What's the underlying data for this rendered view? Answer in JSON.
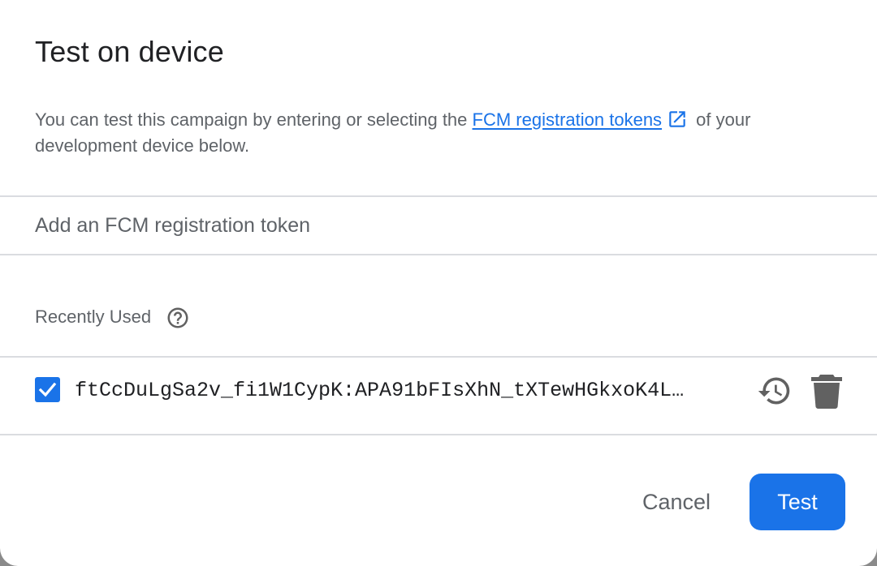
{
  "dialog": {
    "title": "Test on device",
    "description_before": "You can test this campaign by entering or selecting the ",
    "link_text": "FCM registration tokens",
    "description_after": " of your development device below.",
    "input_placeholder": "Add an FCM registration token",
    "input_value": "",
    "recently_used_label": "Recently Used",
    "tokens": [
      {
        "checked": true,
        "value": "ftCcDuLgSa2v_fi1W1CypK:APA91bFIsXhN_tXTewHGkxoK4L…"
      }
    ],
    "cancel_label": "Cancel",
    "test_label": "Test"
  },
  "icons": {
    "external_link": "open-in-new-icon",
    "help": "help-outline-icon",
    "history": "history-icon",
    "delete": "delete-icon",
    "check": "check-icon"
  },
  "colors": {
    "accent": "#1a73e8",
    "title_text": "#202124",
    "secondary_text": "#5f6368",
    "divider": "#dadce0",
    "icon_grey": "#616161"
  }
}
